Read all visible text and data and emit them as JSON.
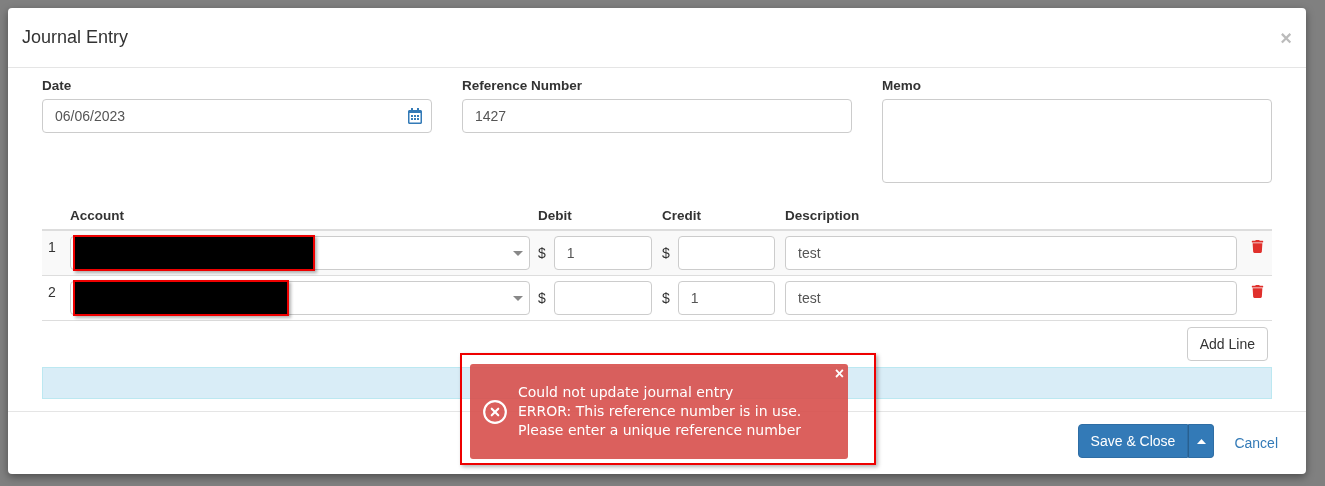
{
  "window": {
    "title": "Journal Entry",
    "close": "×"
  },
  "fields": {
    "date": {
      "label": "Date",
      "value": "06/06/2023"
    },
    "reference": {
      "label": "Reference Number",
      "value": "1427"
    },
    "memo": {
      "label": "Memo"
    }
  },
  "table": {
    "columns": [
      "Account",
      "Debit",
      "Credit",
      "Description"
    ],
    "rows": [
      {
        "number": "1",
        "account_redacted": true,
        "debit": "1",
        "credit": "",
        "description": "test"
      },
      {
        "number": "2",
        "account_redacted": true,
        "debit": "",
        "credit": "1",
        "description": "test"
      }
    ],
    "currency": "$"
  },
  "add_line": "Add Line",
  "toast": {
    "kind": "error",
    "title": "Could not update journal entry",
    "message": "ERROR: This reference number is in use. Please enter a unique reference number",
    "close": "×",
    "highlighted": true
  },
  "footer": {
    "save": "Save & Close",
    "cancel": "Cancel"
  }
}
